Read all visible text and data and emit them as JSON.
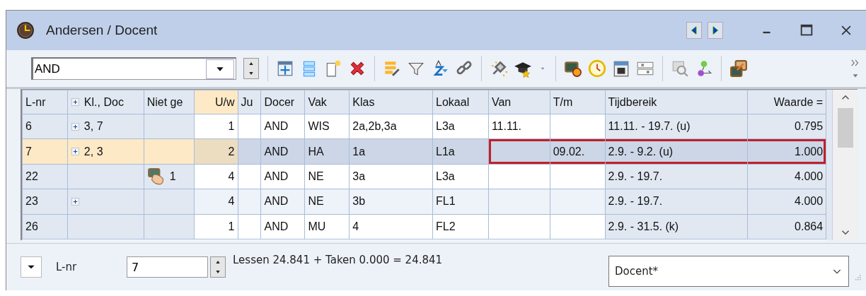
{
  "window": {
    "title": "Andersen / Docent"
  },
  "toolbar": {
    "combo_value": "AND"
  },
  "grid": {
    "columns": [
      {
        "label": "L-nr",
        "kind": "key",
        "numeric": false,
        "sorted": false,
        "expandable": false
      },
      {
        "label": "Kl., Doc",
        "kind": "key",
        "numeric": false,
        "sorted": false,
        "expandable": true
      },
      {
        "label": "Niet ge",
        "kind": "key",
        "numeric": false,
        "sorted": false,
        "expandable": false
      },
      {
        "label": "U/w",
        "kind": "data",
        "numeric": true,
        "sorted": true,
        "expandable": false
      },
      {
        "label": "Ju",
        "kind": "data",
        "numeric": false,
        "sorted": false,
        "expandable": false
      },
      {
        "label": "Docer",
        "kind": "data",
        "numeric": false,
        "sorted": false,
        "expandable": false
      },
      {
        "label": "Vak",
        "kind": "data",
        "numeric": false,
        "sorted": false,
        "expandable": false
      },
      {
        "label": "Klas",
        "kind": "data",
        "numeric": false,
        "sorted": false,
        "expandable": false
      },
      {
        "label": "Lokaal",
        "kind": "data",
        "numeric": false,
        "sorted": false,
        "expandable": false
      },
      {
        "label": "Van",
        "kind": "data",
        "numeric": false,
        "sorted": false,
        "expandable": false
      },
      {
        "label": "T/m",
        "kind": "data",
        "numeric": false,
        "sorted": false,
        "expandable": false
      },
      {
        "label": "Tijdbereik",
        "kind": "derived",
        "numeric": false,
        "sorted": false,
        "expandable": false
      },
      {
        "label": "Waarde =",
        "kind": "derived",
        "numeric": true,
        "sorted": false,
        "expandable": false
      }
    ],
    "rows": [
      {
        "selected": false,
        "expandable": true,
        "framed": false,
        "cells": [
          "6",
          "3, 7",
          null,
          "1",
          null,
          "AND",
          "WIS",
          "2a,2b,3a",
          "L3a",
          "11.11.",
          null,
          "11.11. - 19.7. (u)",
          "0.795"
        ]
      },
      {
        "selected": true,
        "expandable": true,
        "framed": true,
        "cells": [
          "7",
          "2, 3",
          null,
          "2",
          null,
          "AND",
          "HA",
          "1a",
          "L1a",
          null,
          "09.02.",
          "2.9. - 9.2. (u)",
          "1.000"
        ]
      },
      {
        "selected": false,
        "expandable": false,
        "framed": false,
        "cells": [
          "22",
          null,
          "1",
          "4",
          null,
          "AND",
          "NE",
          "3a",
          "L3a",
          null,
          null,
          "2.9. - 19.7.",
          "4.000"
        ]
      },
      {
        "selected": false,
        "expandable": true,
        "framed": false,
        "cells": [
          "23",
          null,
          null,
          "4",
          null,
          "AND",
          "NE",
          "3b",
          "FL1",
          null,
          null,
          "2.9. - 19.7.",
          "4.000"
        ]
      },
      {
        "selected": false,
        "expandable": false,
        "framed": false,
        "cells": [
          "26",
          null,
          null,
          "1",
          null,
          "AND",
          "MU",
          "4",
          "FL2",
          null,
          null,
          "2.9. - 31.5. (k)",
          "0.864"
        ]
      }
    ]
  },
  "footer": {
    "field_label": "L-nr",
    "field_value": "7",
    "summary": "Lessen 24.841 + Taken 0.000 = 24.841",
    "view": "Docent*"
  }
}
